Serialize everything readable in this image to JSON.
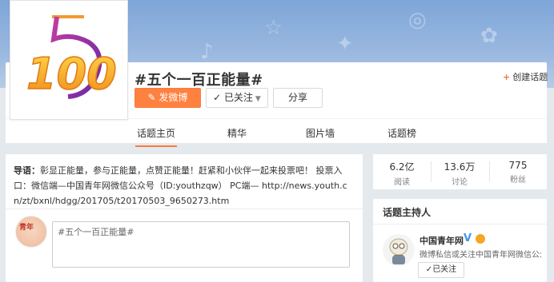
{
  "topic": {
    "title": "#五个一百正能量#",
    "logo_text": "5 100"
  },
  "actions": {
    "post_label": "发微博",
    "follow_label": "已关注",
    "share_label": "分享",
    "create_label": "创建话题"
  },
  "tabs": [
    {
      "label": "话题主页",
      "active": true
    },
    {
      "label": "精华",
      "active": false
    },
    {
      "label": "图片墙",
      "active": false
    },
    {
      "label": "话题榜",
      "active": false
    }
  ],
  "intro": {
    "prefix": "导语：",
    "text": "彰显正能量，参与正能量，点赞正能量！赶紧和小伙伴一起来投票吧！ 投票入口：微信端—中国青年网微信公众号（ID:youthzqw） PC端— http://news.youth.cn/zt/bxnl/hdgg/201705/t20170503_9650273.htm"
  },
  "composer": {
    "prefill": "#五个一百正能量#"
  },
  "stats": [
    {
      "value": "6.2亿",
      "label": "阅读"
    },
    {
      "value": "13.6万",
      "label": "讨论"
    },
    {
      "value": "775",
      "label": "粉丝"
    }
  ],
  "host": {
    "section_title": "话题主持人",
    "name": "中国青年网",
    "verified_mark": "V",
    "description": "微博私信或关注中国青年网微信公众...",
    "follow_label": "已关注"
  },
  "colors": {
    "accent": "#ff8140",
    "banner": "#8fb0de",
    "verified": "#3e97e6"
  }
}
